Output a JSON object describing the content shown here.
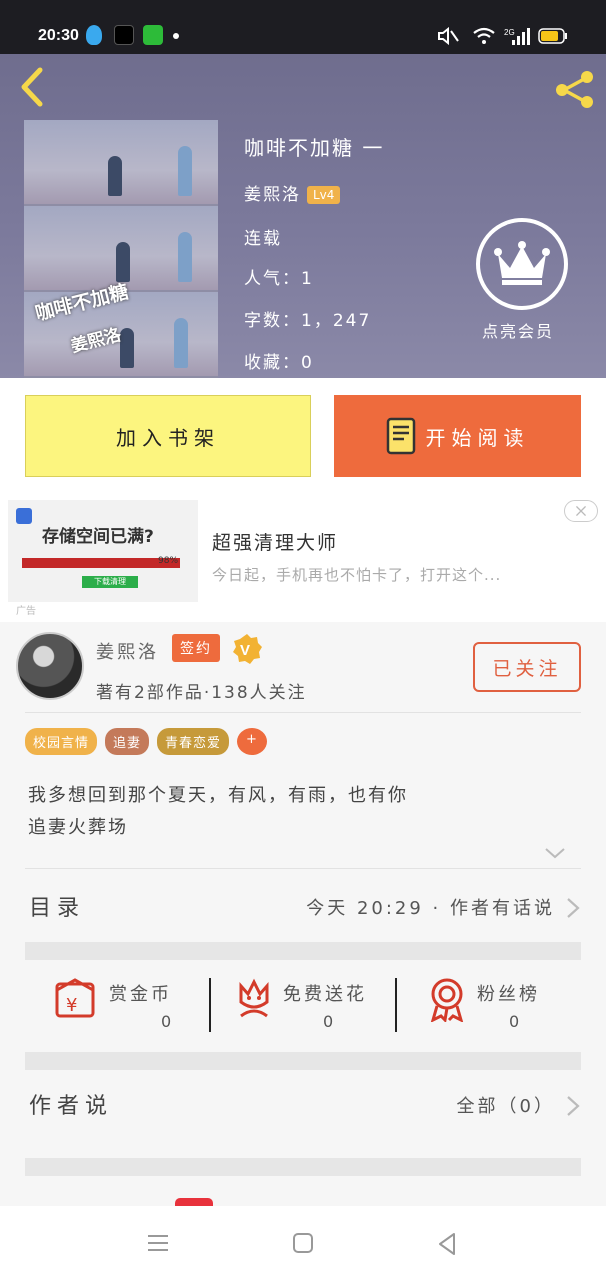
{
  "status_bar": {
    "time": "20:30"
  },
  "book": {
    "title": "咖啡不加糖 一",
    "author": "姜熙洛",
    "level": "Lv4",
    "status": "连载",
    "popularity": "人气：1",
    "word_count": "字数：1，247",
    "favorites": "收藏：0",
    "cover_title": "咖啡不加糖",
    "cover_author": "姜熙洛"
  },
  "vip": {
    "label": "点亮会员"
  },
  "actions": {
    "add_shelf": "加入书架",
    "start_reading": "开始阅读"
  },
  "ad": {
    "image_title": "存储空间已满?",
    "image_percent": "98%",
    "image_button": "下载清理",
    "tag": "广告",
    "title": "超强清理大师",
    "desc": "今日起，手机再也不怕卡了，打开这个..."
  },
  "author_card": {
    "name": "姜熙洛",
    "sign_badge": "签约",
    "stats": "著有2部作品·138人关注",
    "follow_label": "已关注"
  },
  "tags": [
    {
      "label": "校园言情",
      "color": "#f0b24a"
    },
    {
      "label": "追妻",
      "color": "#c47a5a"
    },
    {
      "label": "青春恋爱",
      "color": "#c69a3a"
    },
    {
      "label": "+",
      "color": "#ee6b3d"
    }
  ],
  "description": [
    "我多想回到那个夏天，有风，有雨，也有你",
    "追妻火葬场"
  ],
  "catalog": {
    "label": "目录",
    "right": "今天 20:29 · 作者有话说"
  },
  "rewards": [
    {
      "label": "赏金币",
      "count": "0",
      "icon": "red-envelope-icon"
    },
    {
      "label": "免费送花",
      "count": "0",
      "icon": "flower-icon"
    },
    {
      "label": "粉丝榜",
      "count": "0",
      "icon": "medal-icon"
    }
  ],
  "author_says": {
    "label": "作者说",
    "right": "全部（0）"
  },
  "colors": {
    "accent": "#ee6b3d",
    "shelf": "#fcf57f",
    "hero": "#7c7a9c"
  }
}
